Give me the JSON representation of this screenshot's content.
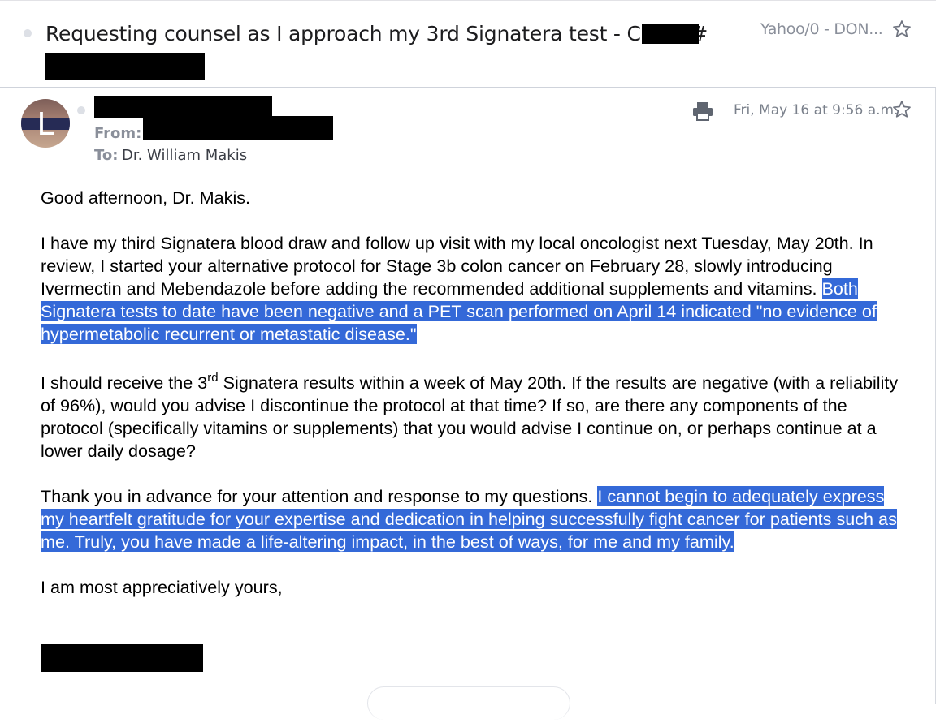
{
  "thread": {
    "subject": "Requesting counsel as I approach my 3rd Signatera test - Client #",
    "folder": "Yahoo/0 - DON..."
  },
  "message": {
    "avatar_letter": "L",
    "from_label": "From:",
    "to_label": "To:",
    "to_value": "Dr. William Makis",
    "date": "Fri, May 16 at 9:56 a.m.",
    "greeting": "Good afternoon, Dr. Makis.",
    "p1_plain": "I have my third Signatera blood draw and follow up visit with my local oncologist next Tuesday, May 20th. In review, I started your alternative protocol for Stage 3b colon cancer on February 28, slowly introducing Ivermectin and Mebendazole before adding the recommended additional supplements and vitamins.",
    "p1_highlight": "Both Signatera tests to date have been negative and a PET scan performed on April 14 indicated \"no evidence of hypermetabolic recurrent or metastatic disease.\"",
    "p2_a": "I should receive the 3",
    "p2_sup": "rd",
    "p2_b": " Signatera results within a week of May 20th. If the results are negative (with a reliability of 96%), would you advise I discontinue the protocol at that time? If so, are there any components of the protocol (specifically vitamins or supplements) that you would advise I continue on, or perhaps continue at a lower daily dosage?",
    "p3_plain": "Thank you in advance for your attention and response to my questions.",
    "p3_highlight": "I cannot begin to adequately express my heartfelt gratitude for your expertise and dedication in helping successfully fight cancer for patients such as me. Truly, you have made a life-altering impact, in the best of ways, for me and my family.",
    "closing": "I am most appreciatively yours,"
  },
  "colors": {
    "highlight": "#3469d8",
    "redaction": "#000000"
  },
  "icons": [
    "star-icon",
    "print-icon",
    "unread-dot-icon"
  ]
}
